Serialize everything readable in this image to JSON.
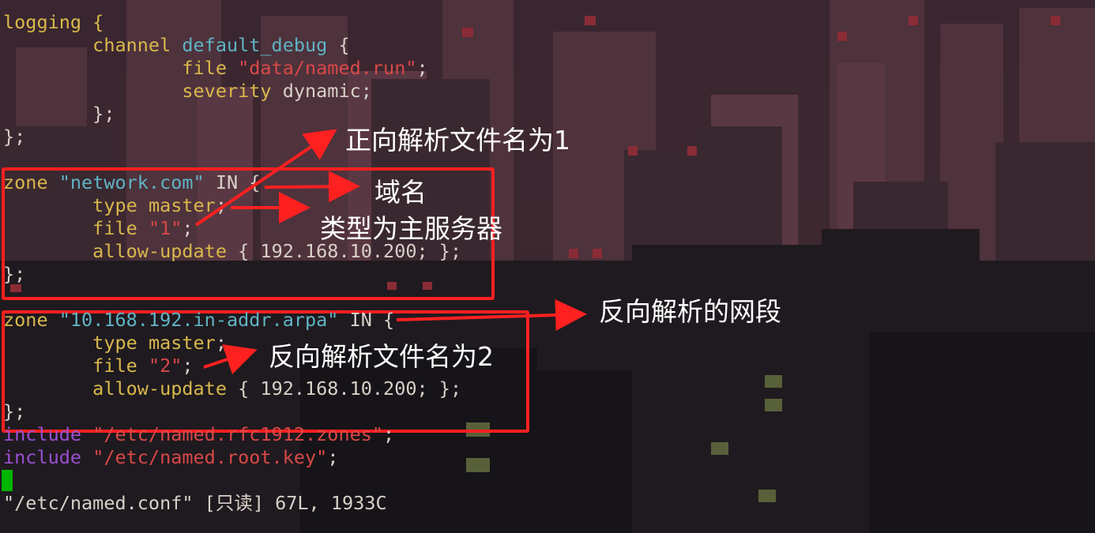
{
  "editor": {
    "lines": [
      [
        {
          "t": "logging {",
          "c": "kw"
        }
      ],
      [
        {
          "t": "        channel ",
          "c": "kw"
        },
        {
          "t": "default_debug",
          "c": "fn"
        },
        {
          "t": " {",
          "c": "wh"
        }
      ],
      [
        {
          "t": "                file ",
          "c": "kw"
        },
        {
          "t": "\"data/named.run\"",
          "c": "str"
        },
        {
          "t": ";",
          "c": "wh"
        }
      ],
      [
        {
          "t": "                severity ",
          "c": "kw"
        },
        {
          "t": "dynamic;",
          "c": "wh"
        }
      ],
      [
        {
          "t": "        };",
          "c": "wh"
        }
      ],
      [
        {
          "t": "};",
          "c": "wh"
        }
      ],
      [],
      [
        {
          "t": "zone ",
          "c": "kw"
        },
        {
          "t": "\"network.com\"",
          "c": "fn"
        },
        {
          "t": " IN {",
          "c": "wh"
        }
      ],
      [
        {
          "t": "        type ",
          "c": "kw"
        },
        {
          "t": "master",
          "c": "kw"
        },
        {
          "t": ";",
          "c": "wh"
        }
      ],
      [
        {
          "t": "        file ",
          "c": "kw"
        },
        {
          "t": "\"1\"",
          "c": "str"
        },
        {
          "t": ";",
          "c": "wh"
        }
      ],
      [
        {
          "t": "        allow-update ",
          "c": "kw"
        },
        {
          "t": "{ 192.168.10.200; };",
          "c": "wh"
        }
      ],
      [
        {
          "t": "};",
          "c": "wh"
        }
      ],
      [],
      [
        {
          "t": "zone ",
          "c": "kw"
        },
        {
          "t": "\"10.168.192.in-addr.arpa\"",
          "c": "fn"
        },
        {
          "t": " IN {",
          "c": "wh"
        }
      ],
      [
        {
          "t": "        type ",
          "c": "kw"
        },
        {
          "t": "master",
          "c": "kw"
        },
        {
          "t": ";",
          "c": "wh"
        }
      ],
      [
        {
          "t": "        file ",
          "c": "kw"
        },
        {
          "t": "\"2\"",
          "c": "str"
        },
        {
          "t": ";",
          "c": "wh"
        }
      ],
      [
        {
          "t": "        allow-update ",
          "c": "kw"
        },
        {
          "t": "{ 192.168.10.200; };",
          "c": "wh"
        }
      ],
      [
        {
          "t": "};",
          "c": "wh"
        }
      ],
      [
        {
          "t": "include ",
          "c": "inc"
        },
        {
          "t": "\"/etc/named.rfc1912.zones\"",
          "c": "str"
        },
        {
          "t": ";",
          "c": "wh"
        }
      ],
      [
        {
          "t": "include ",
          "c": "inc"
        },
        {
          "t": "\"/etc/named.root.key\"",
          "c": "str"
        },
        {
          "t": ";",
          "c": "wh"
        }
      ]
    ],
    "status_line": "\"/etc/named.conf\" [只读] 67L, 1933C"
  },
  "annotations": {
    "forward_file": "正向解析文件名为1",
    "domain": "域名",
    "type_master": "类型为主服务器",
    "reverse_segment": "反向解析的网段",
    "reverse_file": "反向解析文件名为2"
  },
  "colors": {
    "keyword": "#d9b84c",
    "function": "#5fb4c4",
    "string": "#d94848",
    "include": "#9a4fd0",
    "cursor": "#00b400",
    "annotation": "#ff2020"
  }
}
